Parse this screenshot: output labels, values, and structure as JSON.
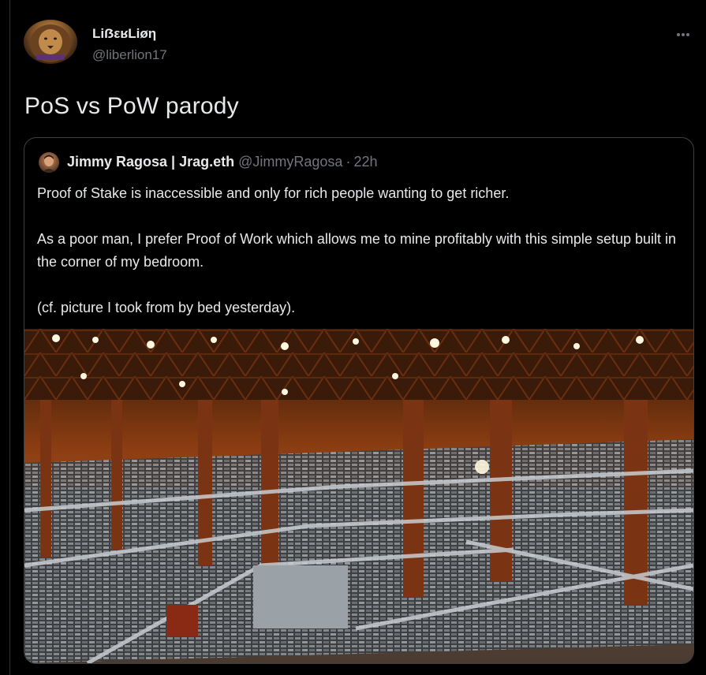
{
  "author": {
    "display_name": "LiẞεʁLiøη",
    "handle": "@liberlion17",
    "avatar_icon": "lion-avatar"
  },
  "tweet": {
    "text": "PoS vs PoW parody"
  },
  "more_icon": "more-horizontal-icon",
  "quote": {
    "author_name": "Jimmy Ragosa | Jrag.eth",
    "author_handle": "@JimmyRagosa",
    "separator": "·",
    "time": "22h",
    "paragraphs": [
      "Proof of Stake is inaccessible and only for rich people wanting to get richer.",
      "As a poor man, I prefer Proof of Work which allows me to mine profitably with this simple setup built in the corner of my bedroom.",
      "(cf. picture I took from by bed yesterday)."
    ],
    "media_icon": "mining-warehouse-photo"
  },
  "colors": {
    "background": "#000000",
    "text_primary": "#e7e9ea",
    "text_secondary": "#71767b",
    "border": "#3e4144"
  }
}
